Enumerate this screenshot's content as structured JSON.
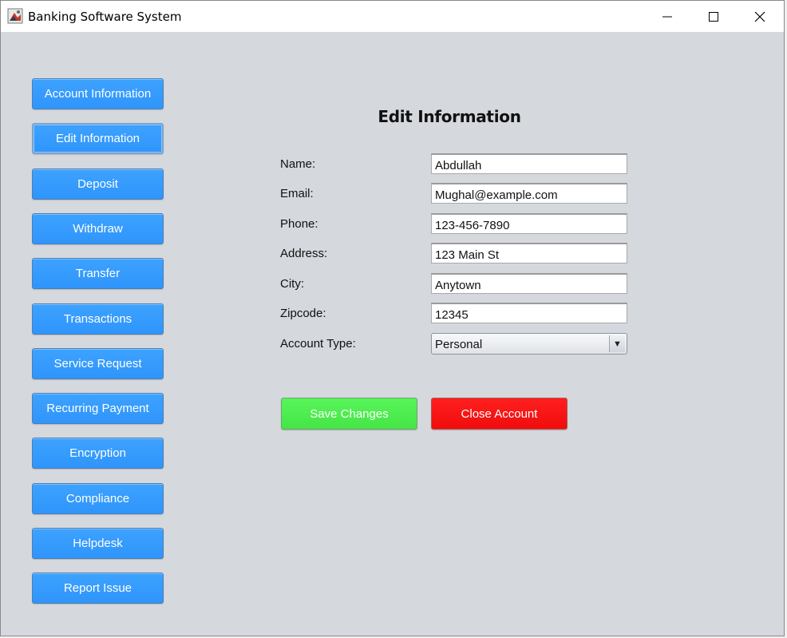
{
  "window": {
    "title": "Banking Software System"
  },
  "icons": {
    "app": "java-app-icon",
    "minimize": "minimize-icon",
    "maximize": "maximize-icon",
    "close": "close-icon",
    "dropdown": "dropdown-arrow-icon"
  },
  "sidebar": {
    "items": [
      {
        "label": "Account Information"
      },
      {
        "label": "Edit Information"
      },
      {
        "label": "Deposit"
      },
      {
        "label": "Withdraw"
      },
      {
        "label": "Transfer"
      },
      {
        "label": "Transactions"
      },
      {
        "label": "Service Request"
      },
      {
        "label": "Recurring Payment"
      },
      {
        "label": "Encryption"
      },
      {
        "label": "Compliance"
      },
      {
        "label": "Helpdesk"
      },
      {
        "label": "Report Issue"
      }
    ],
    "selected": "Edit Information"
  },
  "form": {
    "title": "Edit Information",
    "fields": [
      {
        "label": "Name:",
        "value": "Abdullah"
      },
      {
        "label": "Email:",
        "value": "Mughal@example.com"
      },
      {
        "label": "Phone:",
        "value": "123-456-7890"
      },
      {
        "label": "Address:",
        "value": "123 Main St"
      },
      {
        "label": "City:",
        "value": "Anytown"
      },
      {
        "label": "Zipcode:",
        "value": "12345"
      }
    ],
    "account_type": {
      "label": "Account Type:",
      "value": "Personal"
    },
    "save_label": "Save Changes",
    "close_label": "Close Account"
  },
  "colors": {
    "nav_button": "#2f95fb",
    "save_button": "#45e546",
    "close_button": "#f00c0c",
    "background": "#d5d8dd"
  }
}
